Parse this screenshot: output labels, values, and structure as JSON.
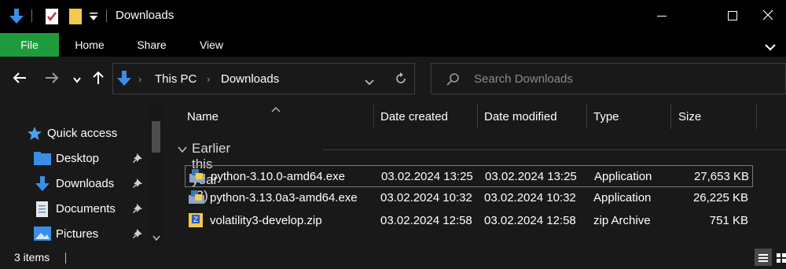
{
  "window": {
    "title": "Downloads",
    "controls": {
      "minimize": "minimize",
      "maximize": "maximize",
      "close": "close"
    }
  },
  "ribbon": {
    "tabs": [
      {
        "label": "File"
      },
      {
        "label": "Home"
      },
      {
        "label": "Share"
      },
      {
        "label": "View"
      }
    ]
  },
  "address": {
    "breadcrumbs": [
      "This PC",
      "Downloads"
    ],
    "search_placeholder": "Search Downloads"
  },
  "nav": {
    "items": [
      {
        "label": "Quick access",
        "icon": "star-icon",
        "pinned": false
      },
      {
        "label": "Desktop",
        "icon": "desktop-folder-icon",
        "pinned": true
      },
      {
        "label": "Downloads",
        "icon": "download-arrow-icon",
        "pinned": true
      },
      {
        "label": "Documents",
        "icon": "documents-icon",
        "pinned": true
      },
      {
        "label": "Pictures",
        "icon": "pictures-icon",
        "pinned": true
      }
    ]
  },
  "columns": {
    "name": "Name",
    "date_created": "Date created",
    "date_modified": "Date modified",
    "type": "Type",
    "size": "Size"
  },
  "group": {
    "label": "Earlier this year (3)"
  },
  "files": [
    {
      "name": "python-3.10.0-amd64.exe",
      "date_created": "03.02.2024 13:25",
      "date_modified": "03.02.2024 13:25",
      "type": "Application",
      "size": "27,653 KB",
      "icon": "python-installer-icon",
      "selected": true
    },
    {
      "name": "python-3.13.0a3-amd64.exe",
      "date_created": "03.02.2024 10:32",
      "date_modified": "03.02.2024 10:32",
      "type": "Application",
      "size": "26,225 KB",
      "icon": "python-installer-icon",
      "selected": false
    },
    {
      "name": "volatility3-develop.zip",
      "date_created": "03.02.2024 12:58",
      "date_modified": "03.02.2024 12:58",
      "type": "zip Archive",
      "size": "751 KB",
      "icon": "zip-archive-icon",
      "selected": false
    }
  ],
  "status": {
    "item_count": "3 items"
  },
  "colors": {
    "file_tab": "#1e9c3d",
    "accent_blue": "#3a8ee6",
    "background": "#191919",
    "titlebar": "#000000"
  }
}
